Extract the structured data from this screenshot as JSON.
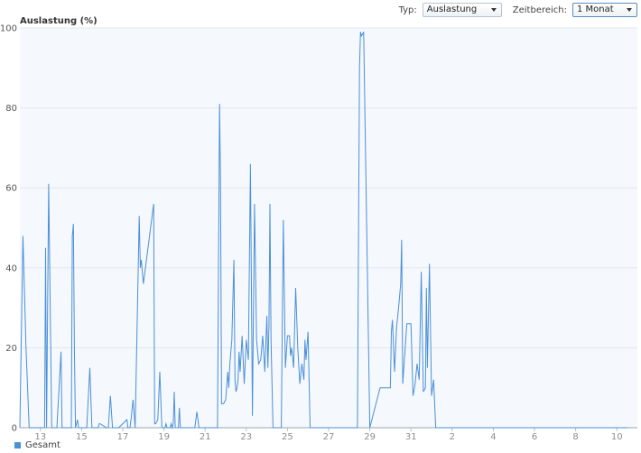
{
  "toolbar": {
    "type_label": "Typ:",
    "type_value": "Auslastung",
    "range_label": "Zeitbereich:",
    "range_value": "1 Monat"
  },
  "chart_data": {
    "type": "line",
    "ylabel": "Auslastung (%)",
    "ylim": [
      0,
      100
    ],
    "yticks": [
      0,
      20,
      40,
      60,
      80,
      100
    ],
    "xticks": [
      "13",
      "15",
      "17",
      "19",
      "21",
      "23",
      "25",
      "27",
      "29",
      "31",
      "2",
      "4",
      "6",
      "8",
      "10"
    ],
    "grid": "horizontal",
    "legend_position": "bottom-left",
    "line_color": "#4a90d9",
    "series": [
      {
        "name": "Gesamt",
        "color": "#4a90d9",
        "x_days": [
          0,
          0.15,
          0.3,
          0.45,
          0.6,
          1.2,
          1.25,
          1.3,
          1.4,
          1.5,
          1.55,
          1.6,
          1.7,
          1.8,
          2.0,
          2.05,
          2.1,
          2.2,
          2.5,
          2.55,
          2.6,
          2.65,
          2.7,
          2.8,
          2.85,
          2.95,
          3.0,
          3.1,
          3.2,
          3.25,
          3.4,
          3.5,
          3.8,
          3.85,
          3.9,
          4.2,
          4.3,
          4.4,
          4.5,
          4.6,
          4.7,
          4.8,
          5.2,
          5.25,
          5.3,
          5.35,
          5.4,
          5.5,
          5.6,
          5.8,
          5.85,
          5.9,
          6.0,
          6.5,
          6.55,
          6.6,
          6.7,
          6.8,
          6.9,
          7.0,
          7.05,
          7.1,
          7.15,
          7.2,
          7.3,
          7.35,
          7.4,
          7.45,
          7.5,
          7.55,
          7.6,
          7.7,
          7.75,
          7.8,
          7.9,
          8.0,
          8.5,
          8.6,
          8.7,
          8.8,
          8.85,
          8.9,
          9.0,
          9.5,
          9.6,
          9.7,
          9.75,
          9.8,
          9.9,
          10.0,
          10.1,
          10.15,
          10.2,
          10.3,
          10.4,
          10.45,
          10.5,
          10.55,
          10.6,
          10.65,
          10.7,
          10.8,
          10.9,
          11.0,
          11.1,
          11.2,
          11.3,
          11.4,
          11.5,
          11.6,
          11.7,
          11.8,
          11.9,
          12.0,
          12.05,
          12.1,
          12.15,
          12.2,
          12.3,
          12.4,
          12.5,
          12.6,
          12.7,
          12.8,
          12.9,
          13.0,
          13.1,
          13.15,
          13.2,
          13.3,
          13.4,
          13.5,
          13.6,
          13.7,
          13.8,
          13.85,
          13.9,
          14.0,
          14.1,
          14.2,
          14.3,
          14.4,
          14.5,
          14.6,
          14.7,
          14.8,
          15.0,
          15.1,
          15.2,
          15.3,
          15.4,
          15.5,
          15.6,
          15.7,
          15.8,
          15.9,
          16.0,
          16.1,
          16.2,
          16.3,
          16.4,
          16.5,
          16.55,
          16.6,
          16.7,
          17.0,
          17.5,
          18.0,
          18.05,
          18.1,
          18.2,
          18.3,
          18.4,
          18.5,
          18.55,
          18.6,
          18.8,
          19.0,
          19.1,
          19.2,
          19.3,
          19.4,
          19.5,
          19.6,
          19.7,
          19.75,
          19.8,
          19.9,
          20.0,
          20.1,
          20.2,
          20.3,
          20.4,
          20.5,
          20.6,
          20.7,
          20.75,
          20.8,
          20.9,
          21.0,
          21.1,
          21.2,
          21.3,
          21.4,
          21.5,
          21.55,
          21.6,
          21.7,
          21.8,
          22.0,
          22.05,
          22.1,
          22.15,
          22.2,
          22.3,
          22.4,
          22.5,
          22.6,
          22.65,
          22.7,
          22.8,
          22.9,
          23.0,
          23.05,
          23.1,
          23.2,
          23.5,
          23.55,
          23.6,
          23.7,
          23.8,
          24.0,
          24.05,
          24.1,
          24.2,
          24.3,
          24.35,
          24.4,
          24.5,
          24.6,
          24.7,
          24.8,
          24.85,
          24.9,
          25.0,
          25.3,
          25.35,
          25.4,
          25.45,
          25.5,
          25.6,
          25.7,
          25.8,
          25.85,
          25.9,
          26.0,
          26.1,
          26.2,
          26.3,
          26.4,
          26.5,
          26.6,
          26.7,
          26.75,
          26.8,
          26.9,
          27.0,
          27.1,
          27.15,
          27.2,
          27.3,
          27.4,
          27.5,
          27.55,
          27.6,
          27.7,
          27.8,
          27.85,
          27.9,
          28.0,
          28.1,
          28.2,
          28.3,
          28.35,
          28.4,
          28.5,
          28.6,
          28.7,
          28.8,
          28.9,
          29.0,
          29.1,
          29.2,
          29.3,
          29.4,
          29.5,
          29.55,
          29.6,
          29.7,
          30.0
        ],
        "values": [
          0,
          48,
          20,
          0,
          0,
          0,
          45,
          0,
          61,
          20,
          0,
          0,
          0,
          0,
          19,
          0,
          0,
          0,
          0,
          48,
          51,
          20,
          0,
          2,
          0,
          0,
          0,
          0,
          0,
          0,
          15,
          0,
          0,
          1,
          1,
          0,
          0,
          8,
          0,
          0,
          0,
          0,
          2,
          0,
          0,
          0,
          2,
          7,
          0,
          53,
          40,
          42,
          36,
          56,
          1,
          1,
          2,
          14,
          0,
          0,
          0,
          1,
          0,
          0,
          0,
          1,
          0,
          1,
          9,
          0,
          0,
          0,
          5,
          0,
          0,
          0,
          0,
          4,
          0,
          0,
          0,
          0,
          0,
          0,
          0,
          81,
          60,
          6,
          6,
          7,
          14,
          10,
          16,
          22,
          42,
          12,
          9,
          10,
          12,
          19,
          14,
          23,
          11,
          22,
          17,
          66,
          3,
          56,
          22,
          16,
          17,
          23,
          14,
          28,
          15,
          25,
          56,
          22,
          0,
          0,
          0,
          0,
          0,
          52,
          15,
          23,
          23,
          18,
          20,
          15,
          35,
          20,
          11,
          16,
          12,
          22,
          17,
          24,
          0,
          0,
          0,
          0,
          0,
          0,
          0,
          0,
          0,
          0,
          0,
          0,
          0,
          0,
          0,
          0,
          0,
          0,
          0,
          0,
          0,
          0,
          0,
          90,
          99,
          98,
          99,
          0,
          10,
          10,
          24,
          27,
          14,
          25,
          30,
          36,
          47,
          11,
          26,
          26,
          8,
          11,
          16,
          12,
          39,
          9,
          10,
          35,
          15,
          41,
          8,
          12,
          0,
          0,
          0,
          0,
          0,
          0,
          0,
          0,
          0,
          0,
          0,
          0,
          0,
          0,
          0,
          0,
          0,
          0,
          0,
          0,
          0,
          0,
          0,
          0,
          0,
          0,
          0,
          0,
          0,
          0,
          0,
          0,
          0,
          0,
          0,
          0,
          0,
          0,
          0,
          0,
          0,
          0,
          0,
          0,
          0,
          0,
          0,
          0,
          0,
          0,
          0,
          0,
          0,
          0,
          0,
          0,
          0,
          0,
          0,
          0,
          0,
          0,
          0,
          0,
          0,
          0,
          0,
          0,
          0,
          0,
          0,
          0,
          0,
          0,
          0,
          0,
          0,
          0,
          0,
          0,
          0,
          0,
          0,
          0,
          0,
          0,
          0,
          0,
          0,
          0,
          0,
          0,
          0,
          0,
          0,
          0,
          0,
          0,
          0,
          0,
          0,
          0,
          0,
          0,
          0,
          0
        ]
      }
    ]
  }
}
